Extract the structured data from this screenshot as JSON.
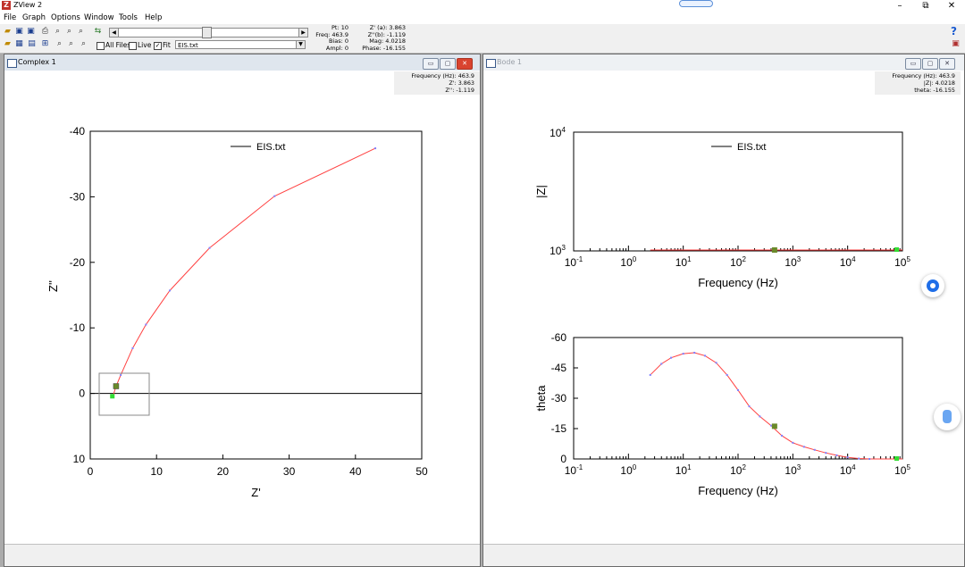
{
  "window": {
    "title": "ZView 2",
    "app_glyph": "Z"
  },
  "menu": [
    "File",
    "Graph",
    "Options",
    "Window",
    "Tools",
    "Help"
  ],
  "toolbar": {
    "all_files_label": "All Files",
    "live_label": "Live",
    "fit_label": "Fit",
    "fit_checked": "✓",
    "file_value": "EIS.txt",
    "readouts_mid": [
      "Pt: 10",
      "Freq: 463.9",
      "Bias: 0",
      "Ampl: 0"
    ],
    "readouts_right": [
      "Z' (a): 3.863",
      "Z''(b): -1.119",
      "Mag: 4.0218",
      "Phase: -16.155"
    ]
  },
  "complex": {
    "title": "Complex 1",
    "info": [
      "Frequency (Hz): 463.9",
      "Z': 3.863",
      "Z'': -1.119"
    ],
    "chart_data": {
      "type": "line",
      "xlabel": "Z'",
      "ylabel": "Z''",
      "xlim": [
        0,
        50
      ],
      "ylim": [
        10,
        -40
      ],
      "x_ticks": [
        "0",
        "10",
        "20",
        "30",
        "40",
        "50"
      ],
      "y_ticks": [
        "-40",
        "-30",
        "-20",
        "-10",
        "0",
        "10"
      ],
      "legend": "EIS.txt",
      "series": [
        {
          "name": "EIS.txt",
          "color": "#ff4040",
          "x": [
            3.4,
            3.9,
            4.6,
            6.4,
            8.4,
            12.0,
            18.0,
            27.8,
            43.0
          ],
          "y": [
            0.5,
            -1.1,
            -2.8,
            -6.9,
            -10.5,
            -15.7,
            -22.2,
            -30.1,
            -37.4
          ]
        }
      ],
      "marker": {
        "x": 3.9,
        "y": -1.1
      },
      "first_point": {
        "x": 3.4,
        "y": 0.5
      }
    }
  },
  "bode": {
    "title": "Bode 1",
    "info": [
      "Frequency (Hz): 463.9",
      "|Z|: 4.0218",
      "theta: -16.155"
    ],
    "top_chart": {
      "type": "line",
      "xlabel": "Frequency (Hz)",
      "ylabel": "|Z|",
      "x_scale": "log",
      "y_scale": "log",
      "xlim": [
        0.1,
        100000
      ],
      "ylim": [
        1000,
        10000
      ],
      "x_ticks": [
        "10",
        "10",
        "10",
        "10",
        "10",
        "10",
        "10"
      ],
      "x_tick_exps": [
        "-1",
        "0",
        "1",
        "2",
        "3",
        "4",
        "5"
      ],
      "y_ticks": [
        "10",
        "10"
      ],
      "y_tick_exps": [
        "4",
        "3"
      ],
      "legend": "EIS.txt",
      "marker_freq": 463.9,
      "end_freq": 80000
    },
    "bottom_chart": {
      "type": "line",
      "xlabel": "Frequency (Hz)",
      "ylabel": "theta",
      "x_scale": "log",
      "xlim": [
        0.1,
        100000
      ],
      "ylim": [
        0,
        -60
      ],
      "x_ticks": [
        "10",
        "10",
        "10",
        "10",
        "10",
        "10",
        "10"
      ],
      "x_tick_exps": [
        "-1",
        "0",
        "1",
        "2",
        "3",
        "4",
        "5"
      ],
      "y_ticks": [
        "-60",
        "-45",
        "-30",
        "-15",
        "0"
      ],
      "series": [
        {
          "name": "EIS.txt",
          "color": "#ff4040",
          "freq": [
            2.5,
            4,
            6,
            10,
            16,
            25,
            40,
            63,
            100,
            160,
            250,
            400,
            630,
            1000,
            1600,
            2500,
            4000,
            6300,
            10000,
            16000,
            25000
          ],
          "theta": [
            -41.5,
            -47,
            -50,
            -52,
            -52.5,
            -51,
            -47.5,
            -41.5,
            -34,
            -26,
            -21,
            -16.5,
            -11.5,
            -8,
            -6,
            -4.5,
            -3,
            -1.8,
            -0.8,
            -0.2,
            0
          ]
        }
      ],
      "marker": {
        "freq": 463.9,
        "theta": -16.155
      },
      "end_freq": 80000
    }
  }
}
